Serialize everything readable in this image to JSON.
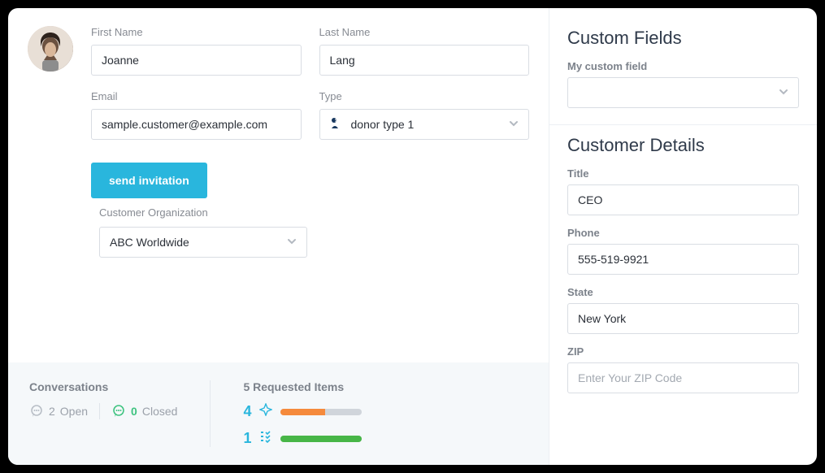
{
  "profile": {
    "first_name_label": "First Name",
    "first_name": "Joanne",
    "last_name_label": "Last Name",
    "last_name": "Lang",
    "email_label": "Email",
    "email": "sample.customer@example.com",
    "type_label": "Type",
    "type_value": "donor type 1",
    "send_invitation_label": "send invitation",
    "org_label": "Customer Organization",
    "org_value": "ABC Worldwide"
  },
  "stats": {
    "conversations_label": "Conversations",
    "open_count": "2",
    "open_label": "Open",
    "closed_count": "0",
    "closed_label": "Closed",
    "requested_items_label": "5 Requested Items",
    "pending_count": "4",
    "completed_count": "1",
    "colors": {
      "open_icon": "#b8bec6",
      "closed_icon": "#3fc380",
      "pending_num": "#29b6dd",
      "pending_bar": "#f58a3c",
      "completed_num": "#29b6dd",
      "completed_bar": "#47b647"
    },
    "pending_progress_pct": 55,
    "completed_progress_pct": 100
  },
  "custom_fields": {
    "heading": "Custom Fields",
    "field_label": "My custom field",
    "field_value": ""
  },
  "customer_details": {
    "heading": "Customer Details",
    "title_label": "Title",
    "title": "CEO",
    "phone_label": "Phone",
    "phone": "555-519-9921",
    "state_label": "State",
    "state": "New York",
    "zip_label": "ZIP",
    "zip": "",
    "zip_placeholder": "Enter Your ZIP Code"
  }
}
